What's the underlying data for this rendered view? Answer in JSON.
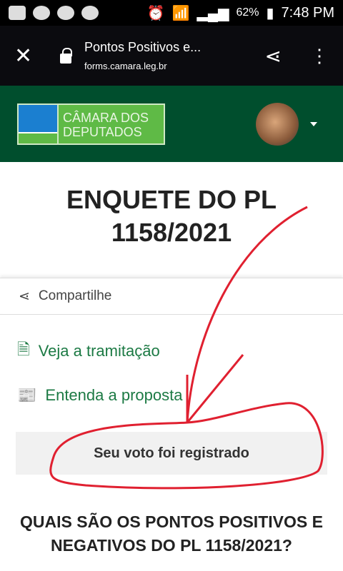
{
  "status_bar": {
    "battery": "62%",
    "time": "7:48 PM"
  },
  "browser": {
    "title": "Pontos Positivos e...",
    "url": "forms.camara.leg.br"
  },
  "header": {
    "logo_text_1": "CÂMARA DOS",
    "logo_text_2": "DEPUTADOS"
  },
  "main": {
    "title": "ENQUETE DO PL 1158/2021",
    "share_label": "Compartilhe",
    "link_tramitacao": "Veja a tramitação",
    "link_proposta": "Entenda a proposta",
    "vote_message": "Seu voto foi registrado",
    "question": "QUAIS SÃO OS PONTOS POSITIVOS E NEGATIVOS DO PL 1158/2021?"
  },
  "colors": {
    "header_green": "#004e2d",
    "link_green": "#1c7a44",
    "annotation_red": "#e02030"
  }
}
